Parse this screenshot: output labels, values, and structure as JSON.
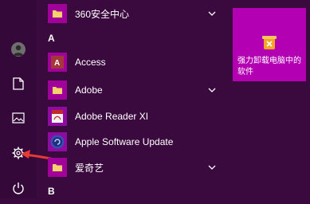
{
  "start_menu": {
    "rail": {
      "items": [
        {
          "icon": "user-avatar-icon"
        },
        {
          "icon": "document-icon"
        },
        {
          "icon": "pictures-icon"
        },
        {
          "icon": "settings-gear-icon"
        },
        {
          "icon": "power-icon"
        }
      ]
    },
    "app_list": {
      "top_item": {
        "label": "360安全中心",
        "icon": "folder-icon"
      },
      "section_a": "A",
      "items": [
        {
          "label": "Access",
          "icon": "access-app-icon"
        },
        {
          "label": "Adobe",
          "icon": "folder-icon"
        },
        {
          "label": "Adobe Reader XI",
          "icon": "adobe-reader-icon"
        },
        {
          "label": "Apple Software Update",
          "icon": "apple-software-update-icon"
        },
        {
          "label": "爱奇艺",
          "icon": "folder-icon"
        }
      ],
      "section_b": "B"
    },
    "tile": {
      "label": "强力卸载电脑中的软件",
      "icon": "uninstaller-icon"
    },
    "annotation": {
      "arrow_color": "#e53935"
    }
  }
}
